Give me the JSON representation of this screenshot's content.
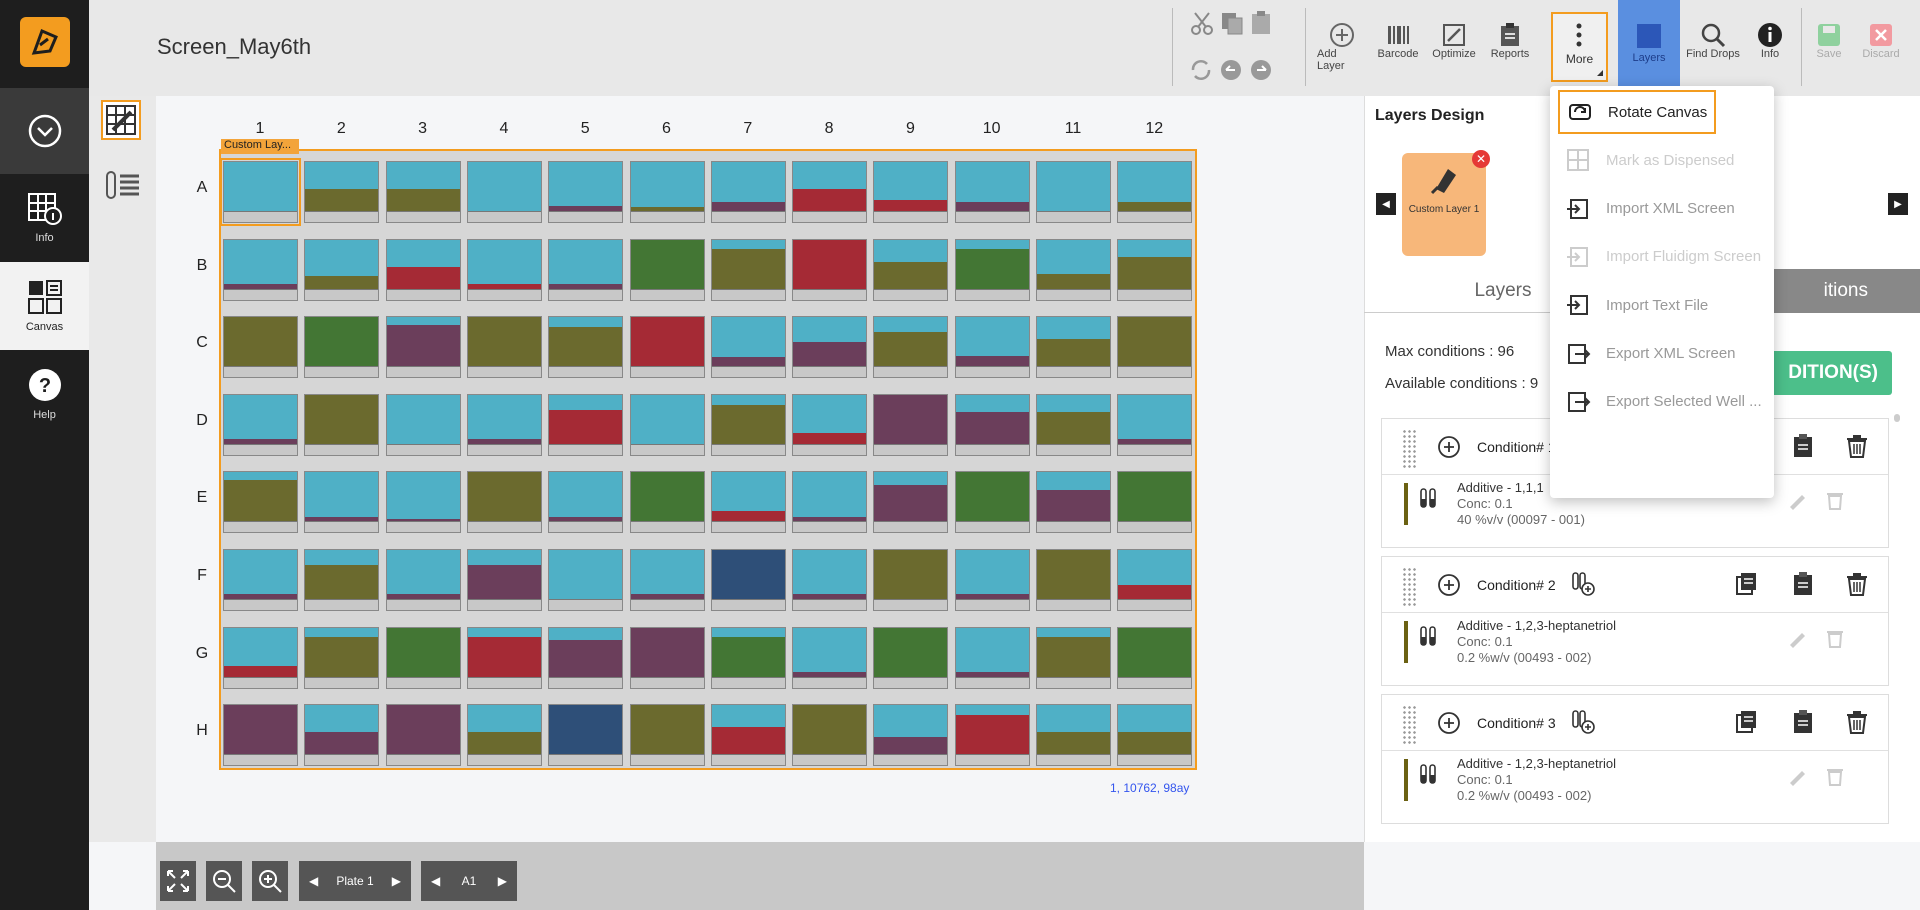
{
  "app": {
    "screen_title": "Screen_May6th"
  },
  "sidebar": {
    "items": [
      {
        "label": "Info"
      },
      {
        "label": "Canvas"
      },
      {
        "label": "Help"
      }
    ]
  },
  "toolbar": {
    "add_layer": "Add Layer",
    "barcode": "Barcode",
    "optimize": "Optimize",
    "reports": "Reports",
    "more": "More",
    "layers": "Layers",
    "find_drops": "Find Drops",
    "info": "Info",
    "save": "Save",
    "discard": "Discard"
  },
  "more_menu": {
    "items": [
      {
        "label": "Rotate Canvas",
        "state": "enabled"
      },
      {
        "label": "Mark as Dispensed",
        "state": "disabled"
      },
      {
        "label": "Import XML Screen",
        "state": "enabled"
      },
      {
        "label": "Import Fluidigm Screen",
        "state": "disabled"
      },
      {
        "label": "Import Text File",
        "state": "enabled"
      },
      {
        "label": "Export XML Screen",
        "state": "enabled"
      },
      {
        "label": "Export Selected Well ...",
        "state": "enabled"
      }
    ]
  },
  "plate": {
    "columns": [
      "1",
      "2",
      "3",
      "4",
      "5",
      "6",
      "7",
      "8",
      "9",
      "10",
      "11",
      "12"
    ],
    "rows": [
      "A",
      "B",
      "C",
      "D",
      "E",
      "F",
      "G",
      "H"
    ],
    "layer_tag": "Custom Lay...",
    "coord_readout": "1, 10762, 98ay",
    "colors": {
      "cyan": "#4fb0c6",
      "olive": "#6b6a2e",
      "red": "#a52a35",
      "green": "#437634",
      "purple": "#6b3e5b",
      "navy": "#2e4f78"
    },
    "wells": [
      [
        [
          "olive",
          0.0
        ],
        [
          "olive",
          0.45
        ],
        [
          "olive",
          0.45
        ],
        [
          "olive",
          0.0
        ],
        [
          "purple",
          0.1
        ],
        [
          "olive",
          0.08
        ],
        [
          "purple",
          0.18
        ],
        [
          "red",
          0.45
        ],
        [
          "red",
          0.22
        ],
        [
          "purple",
          0.18
        ],
        [
          "olive",
          0.0
        ],
        [
          "olive",
          0.18
        ]
      ],
      [
        [
          "purple",
          0.1
        ],
        [
          "olive",
          0.25
        ],
        [
          "red",
          0.45
        ],
        [
          "red",
          0.1
        ],
        [
          "purple",
          0.1
        ],
        [
          "green",
          1.0
        ],
        [
          "olive",
          0.8
        ],
        [
          "red",
          1.0
        ],
        [
          "olive",
          0.55
        ],
        [
          "green",
          0.8
        ],
        [
          "olive",
          0.3
        ],
        [
          "olive",
          0.65
        ]
      ],
      [
        [
          "olive",
          1.0
        ],
        [
          "green",
          1.0
        ],
        [
          "purple",
          0.85
        ],
        [
          "olive",
          1.0
        ],
        [
          "olive",
          0.8
        ],
        [
          "red",
          1.0
        ],
        [
          "purple",
          0.18
        ],
        [
          "purple",
          0.5
        ],
        [
          "olive",
          0.7
        ],
        [
          "purple",
          0.2
        ],
        [
          "olive",
          0.55
        ],
        [
          "olive",
          1.0
        ]
      ],
      [
        [
          "purple",
          0.1
        ],
        [
          "olive",
          1.0
        ],
        [
          "olive",
          0.0
        ],
        [
          "purple",
          0.1
        ],
        [
          "red",
          0.7
        ],
        [
          "olive",
          0.0
        ],
        [
          "olive",
          0.8
        ],
        [
          "red",
          0.22
        ],
        [
          "purple",
          1.0
        ],
        [
          "purple",
          0.65
        ],
        [
          "olive",
          0.65
        ],
        [
          "purple",
          0.1
        ]
      ],
      [
        [
          "olive",
          0.85
        ],
        [
          "purple",
          0.08
        ],
        [
          "purple",
          0.05
        ],
        [
          "olive",
          1.0
        ],
        [
          "purple",
          0.08
        ],
        [
          "green",
          1.0
        ],
        [
          "red",
          0.22
        ],
        [
          "purple",
          0.08
        ],
        [
          "purple",
          0.75
        ],
        [
          "green",
          1.0
        ],
        [
          "purple",
          0.65
        ],
        [
          "green",
          1.0
        ]
      ],
      [
        [
          "purple",
          0.1
        ],
        [
          "olive",
          0.7
        ],
        [
          "purple",
          0.1
        ],
        [
          "purple",
          0.7
        ],
        [
          "olive",
          0.0
        ],
        [
          "purple",
          0.1
        ],
        [
          "navy",
          1.0
        ],
        [
          "purple",
          0.1
        ],
        [
          "olive",
          1.0
        ],
        [
          "purple",
          0.1
        ],
        [
          "olive",
          1.0
        ],
        [
          "red",
          0.28
        ]
      ],
      [
        [
          "red",
          0.22
        ],
        [
          "olive",
          0.8
        ],
        [
          "green",
          1.0
        ],
        [
          "red",
          0.8
        ],
        [
          "purple",
          0.75
        ],
        [
          "purple",
          1.0
        ],
        [
          "green",
          0.8
        ],
        [
          "purple",
          0.1
        ],
        [
          "green",
          1.0
        ],
        [
          "purple",
          0.1
        ],
        [
          "olive",
          0.8
        ],
        [
          "green",
          1.0
        ]
      ],
      [
        [
          "purple",
          1.0
        ],
        [
          "purple",
          0.45
        ],
        [
          "purple",
          1.0
        ],
        [
          "olive",
          0.45
        ],
        [
          "navy",
          1.0
        ],
        [
          "olive",
          1.0
        ],
        [
          "red",
          0.55
        ],
        [
          "olive",
          1.0
        ],
        [
          "purple",
          0.35
        ],
        [
          "red",
          0.8
        ],
        [
          "olive",
          0.45
        ],
        [
          "olive",
          0.45
        ]
      ]
    ]
  },
  "bottom": {
    "plate_label": "Plate 1",
    "well_label": "A1"
  },
  "right_panel": {
    "title": "Layers Design",
    "layer_card": "Custom Layer 1",
    "tab_layers": "Layers",
    "tab_conditions": "itions",
    "max_conditions": "Max conditions : 96",
    "available_conditions": "Available conditions : 9",
    "add_conditions": "DITION(S)",
    "conditions": [
      {
        "name": "Condition# 1",
        "line1": "Additive - 1,1,1",
        "line2": "Conc: 0.1",
        "line3": "40 %v/v (00097 - 001)"
      },
      {
        "name": "Condition# 2",
        "line1": "Additive - 1,2,3-heptanetriol",
        "line2": "Conc: 0.1",
        "line3": "0.2 %w/v (00493 - 002)"
      },
      {
        "name": "Condition# 3",
        "line1": "Additive - 1,2,3-heptanetriol",
        "line2": "Conc: 0.1",
        "line3": "0.2 %w/v (00493 - 002)"
      }
    ]
  }
}
